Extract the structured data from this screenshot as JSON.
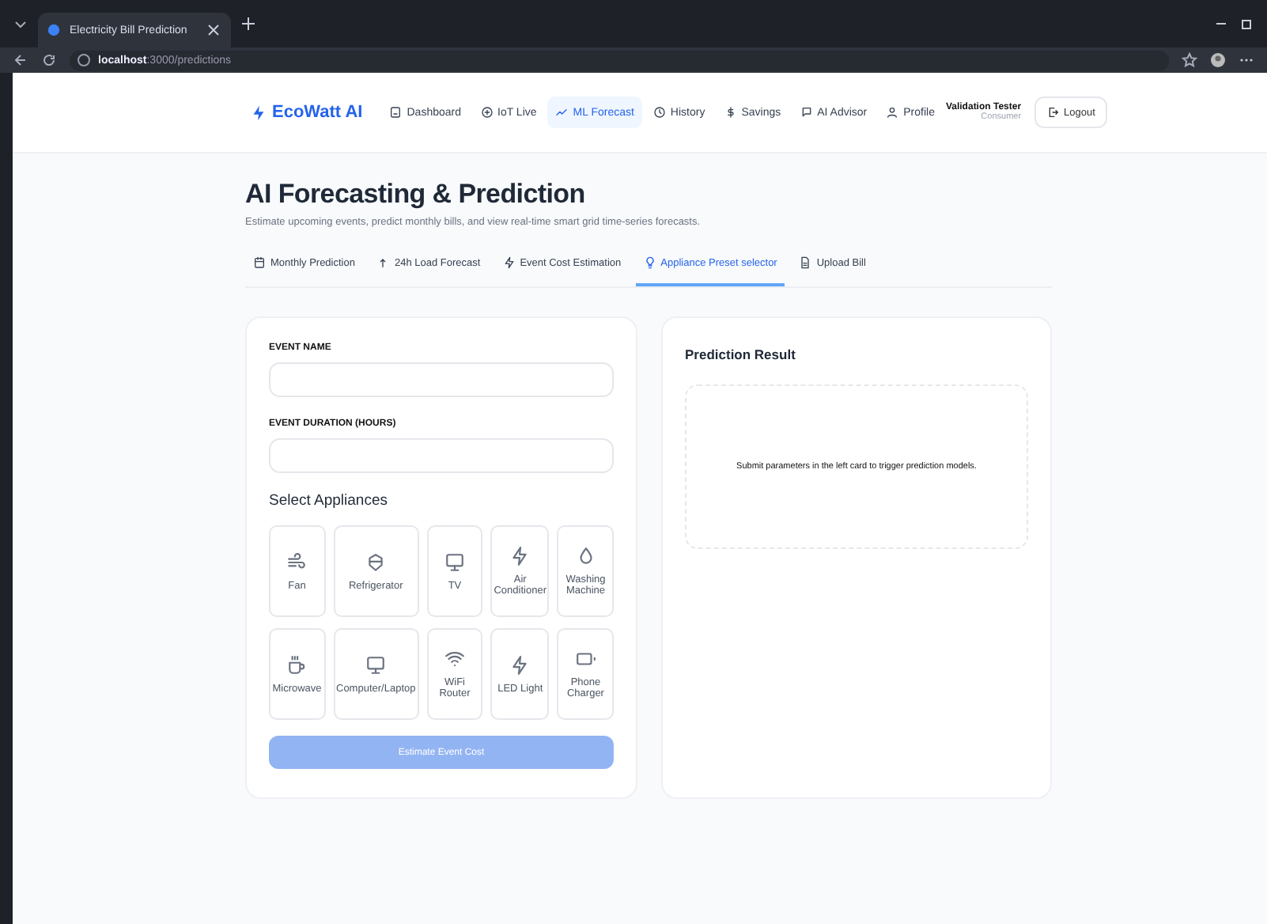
{
  "browser": {
    "tab_title": "Electricity Bill Prediction",
    "address": "**localhost**:3000/predictions"
  },
  "nav": {
    "brand": "EcoWatt AI",
    "items": [
      {
        "label": "Dashboard",
        "selected": false
      },
      {
        "label": "IoT Live",
        "selected": false
      },
      {
        "label": "ML Forecast",
        "selected": true
      },
      {
        "label": "History",
        "selected": false
      },
      {
        "label": "Savings",
        "selected": false
      },
      {
        "label": "AI Advisor",
        "selected": false
      },
      {
        "label": "Profile",
        "selected": false
      }
    ],
    "user_name": "Validation Tester",
    "user_role": "Consumer",
    "logout": "Logout"
  },
  "page": {
    "title": "AI Forecasting & Prediction",
    "subtitle": "Estimate upcoming events, predict monthly bills, and view real-time smart grid time-series forecasts.",
    "tabs": [
      {
        "label": "Monthly Prediction",
        "selected": false
      },
      {
        "label": "24h Load Forecast",
        "selected": false
      },
      {
        "label": "Event Cost Estimation",
        "selected": false
      },
      {
        "label": "Appliance Preset selector",
        "selected": true
      },
      {
        "label": "Upload Bill",
        "selected": false
      }
    ]
  },
  "form": {
    "fields": [
      {
        "label": "EVENT NAME"
      },
      {
        "label": "EVENT DURATION (HOURS)"
      }
    ],
    "appliances_title": "Select Appliances",
    "appliances": [
      {
        "label": "Fan"
      },
      {
        "label": "Refrigerator"
      },
      {
        "label": "TV"
      },
      {
        "label": "Air Conditioner"
      },
      {
        "label": "Washing Machine"
      },
      {
        "label": "Microwave"
      },
      {
        "label": "Computer/Laptop"
      },
      {
        "label": "WiFi Router"
      },
      {
        "label": "LED Light"
      },
      {
        "label": "Phone Charger"
      }
    ],
    "submit": {
      "label": "Estimate Event Cost",
      "disabled": true
    }
  },
  "result": {
    "title": "Prediction Result",
    "message": "Submit parameters in the left card to trigger prediction models."
  }
}
